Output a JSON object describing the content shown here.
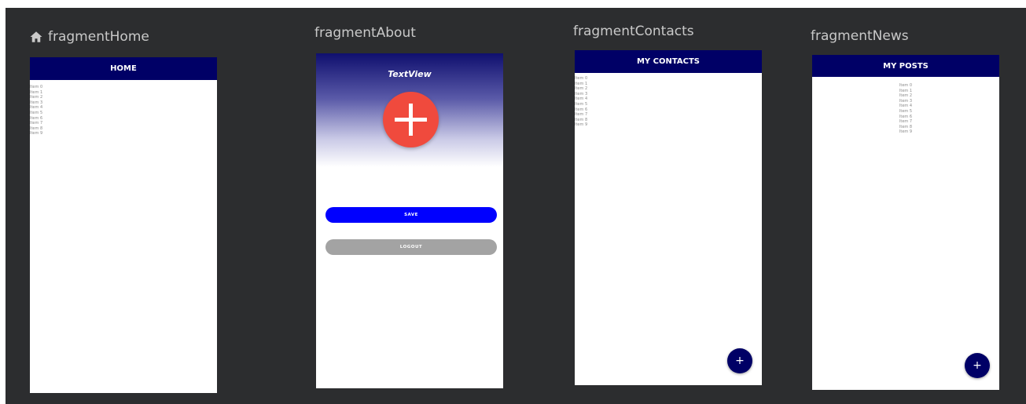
{
  "fragments": {
    "home": {
      "title": "fragmentHome",
      "appbar_title": "HOME",
      "items": [
        "Item 0",
        "Item 1",
        "Item 2",
        "Item 3",
        "Item 4",
        "Item 5",
        "Item 6",
        "Item 7",
        "Item 8",
        "Item 9"
      ]
    },
    "about": {
      "title": "fragmentAbout",
      "textview": "TextView",
      "save_label": "SAVE",
      "logout_label": "LOGOUT"
    },
    "contacts": {
      "title": "fragmentContacts",
      "appbar_title": "MY CONTACTS",
      "items": [
        "Item 0",
        "Item 1",
        "Item 2",
        "Item 3",
        "Item 4",
        "Item 5",
        "Item 6",
        "Item 7",
        "Item 8",
        "Item 9"
      ],
      "fab_symbol": "+"
    },
    "news": {
      "title": "fragmentNews",
      "appbar_title": "MY POSTS",
      "items": [
        "Item 0",
        "Item 1",
        "Item 2",
        "Item 3",
        "Item 4",
        "Item 5",
        "Item 6",
        "Item 7",
        "Item 8",
        "Item 9"
      ],
      "fab_symbol": "+"
    }
  },
  "colors": {
    "canvas_bg": "#2c2d2f",
    "appbar": "#000066",
    "fab_big": "#f04a3d",
    "save_button": "#0000ff",
    "logout_button": "#a3a3a3"
  },
  "icons": {
    "home_title_icon": "home-icon",
    "about_fab_icon": "plus-icon",
    "contacts_fab_icon": "plus-icon",
    "news_fab_icon": "plus-icon"
  }
}
